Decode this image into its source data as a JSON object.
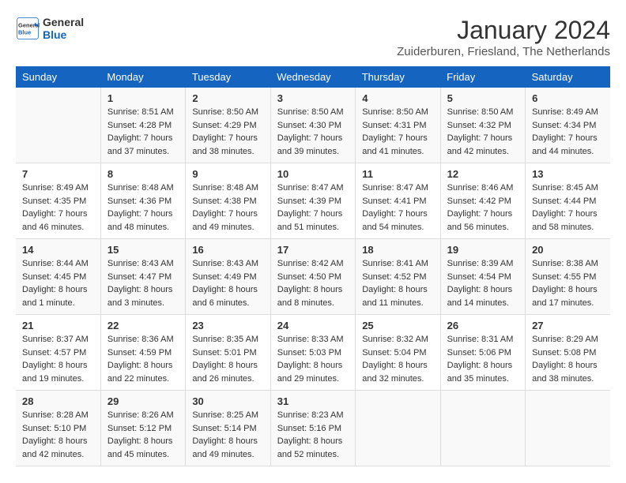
{
  "header": {
    "logo_general": "General",
    "logo_blue": "Blue",
    "month": "January 2024",
    "location": "Zuiderburen, Friesland, The Netherlands"
  },
  "days_of_week": [
    "Sunday",
    "Monday",
    "Tuesday",
    "Wednesday",
    "Thursday",
    "Friday",
    "Saturday"
  ],
  "weeks": [
    [
      {
        "num": "",
        "sunrise": "",
        "sunset": "",
        "daylight": ""
      },
      {
        "num": "1",
        "sunrise": "Sunrise: 8:51 AM",
        "sunset": "Sunset: 4:28 PM",
        "daylight": "Daylight: 7 hours and 37 minutes."
      },
      {
        "num": "2",
        "sunrise": "Sunrise: 8:50 AM",
        "sunset": "Sunset: 4:29 PM",
        "daylight": "Daylight: 7 hours and 38 minutes."
      },
      {
        "num": "3",
        "sunrise": "Sunrise: 8:50 AM",
        "sunset": "Sunset: 4:30 PM",
        "daylight": "Daylight: 7 hours and 39 minutes."
      },
      {
        "num": "4",
        "sunrise": "Sunrise: 8:50 AM",
        "sunset": "Sunset: 4:31 PM",
        "daylight": "Daylight: 7 hours and 41 minutes."
      },
      {
        "num": "5",
        "sunrise": "Sunrise: 8:50 AM",
        "sunset": "Sunset: 4:32 PM",
        "daylight": "Daylight: 7 hours and 42 minutes."
      },
      {
        "num": "6",
        "sunrise": "Sunrise: 8:49 AM",
        "sunset": "Sunset: 4:34 PM",
        "daylight": "Daylight: 7 hours and 44 minutes."
      }
    ],
    [
      {
        "num": "7",
        "sunrise": "Sunrise: 8:49 AM",
        "sunset": "Sunset: 4:35 PM",
        "daylight": "Daylight: 7 hours and 46 minutes."
      },
      {
        "num": "8",
        "sunrise": "Sunrise: 8:48 AM",
        "sunset": "Sunset: 4:36 PM",
        "daylight": "Daylight: 7 hours and 48 minutes."
      },
      {
        "num": "9",
        "sunrise": "Sunrise: 8:48 AM",
        "sunset": "Sunset: 4:38 PM",
        "daylight": "Daylight: 7 hours and 49 minutes."
      },
      {
        "num": "10",
        "sunrise": "Sunrise: 8:47 AM",
        "sunset": "Sunset: 4:39 PM",
        "daylight": "Daylight: 7 hours and 51 minutes."
      },
      {
        "num": "11",
        "sunrise": "Sunrise: 8:47 AM",
        "sunset": "Sunset: 4:41 PM",
        "daylight": "Daylight: 7 hours and 54 minutes."
      },
      {
        "num": "12",
        "sunrise": "Sunrise: 8:46 AM",
        "sunset": "Sunset: 4:42 PM",
        "daylight": "Daylight: 7 hours and 56 minutes."
      },
      {
        "num": "13",
        "sunrise": "Sunrise: 8:45 AM",
        "sunset": "Sunset: 4:44 PM",
        "daylight": "Daylight: 7 hours and 58 minutes."
      }
    ],
    [
      {
        "num": "14",
        "sunrise": "Sunrise: 8:44 AM",
        "sunset": "Sunset: 4:45 PM",
        "daylight": "Daylight: 8 hours and 1 minute."
      },
      {
        "num": "15",
        "sunrise": "Sunrise: 8:43 AM",
        "sunset": "Sunset: 4:47 PM",
        "daylight": "Daylight: 8 hours and 3 minutes."
      },
      {
        "num": "16",
        "sunrise": "Sunrise: 8:43 AM",
        "sunset": "Sunset: 4:49 PM",
        "daylight": "Daylight: 8 hours and 6 minutes."
      },
      {
        "num": "17",
        "sunrise": "Sunrise: 8:42 AM",
        "sunset": "Sunset: 4:50 PM",
        "daylight": "Daylight: 8 hours and 8 minutes."
      },
      {
        "num": "18",
        "sunrise": "Sunrise: 8:41 AM",
        "sunset": "Sunset: 4:52 PM",
        "daylight": "Daylight: 8 hours and 11 minutes."
      },
      {
        "num": "19",
        "sunrise": "Sunrise: 8:39 AM",
        "sunset": "Sunset: 4:54 PM",
        "daylight": "Daylight: 8 hours and 14 minutes."
      },
      {
        "num": "20",
        "sunrise": "Sunrise: 8:38 AM",
        "sunset": "Sunset: 4:55 PM",
        "daylight": "Daylight: 8 hours and 17 minutes."
      }
    ],
    [
      {
        "num": "21",
        "sunrise": "Sunrise: 8:37 AM",
        "sunset": "Sunset: 4:57 PM",
        "daylight": "Daylight: 8 hours and 19 minutes."
      },
      {
        "num": "22",
        "sunrise": "Sunrise: 8:36 AM",
        "sunset": "Sunset: 4:59 PM",
        "daylight": "Daylight: 8 hours and 22 minutes."
      },
      {
        "num": "23",
        "sunrise": "Sunrise: 8:35 AM",
        "sunset": "Sunset: 5:01 PM",
        "daylight": "Daylight: 8 hours and 26 minutes."
      },
      {
        "num": "24",
        "sunrise": "Sunrise: 8:33 AM",
        "sunset": "Sunset: 5:03 PM",
        "daylight": "Daylight: 8 hours and 29 minutes."
      },
      {
        "num": "25",
        "sunrise": "Sunrise: 8:32 AM",
        "sunset": "Sunset: 5:04 PM",
        "daylight": "Daylight: 8 hours and 32 minutes."
      },
      {
        "num": "26",
        "sunrise": "Sunrise: 8:31 AM",
        "sunset": "Sunset: 5:06 PM",
        "daylight": "Daylight: 8 hours and 35 minutes."
      },
      {
        "num": "27",
        "sunrise": "Sunrise: 8:29 AM",
        "sunset": "Sunset: 5:08 PM",
        "daylight": "Daylight: 8 hours and 38 minutes."
      }
    ],
    [
      {
        "num": "28",
        "sunrise": "Sunrise: 8:28 AM",
        "sunset": "Sunset: 5:10 PM",
        "daylight": "Daylight: 8 hours and 42 minutes."
      },
      {
        "num": "29",
        "sunrise": "Sunrise: 8:26 AM",
        "sunset": "Sunset: 5:12 PM",
        "daylight": "Daylight: 8 hours and 45 minutes."
      },
      {
        "num": "30",
        "sunrise": "Sunrise: 8:25 AM",
        "sunset": "Sunset: 5:14 PM",
        "daylight": "Daylight: 8 hours and 49 minutes."
      },
      {
        "num": "31",
        "sunrise": "Sunrise: 8:23 AM",
        "sunset": "Sunset: 5:16 PM",
        "daylight": "Daylight: 8 hours and 52 minutes."
      },
      {
        "num": "",
        "sunrise": "",
        "sunset": "",
        "daylight": ""
      },
      {
        "num": "",
        "sunrise": "",
        "sunset": "",
        "daylight": ""
      },
      {
        "num": "",
        "sunrise": "",
        "sunset": "",
        "daylight": ""
      }
    ]
  ]
}
